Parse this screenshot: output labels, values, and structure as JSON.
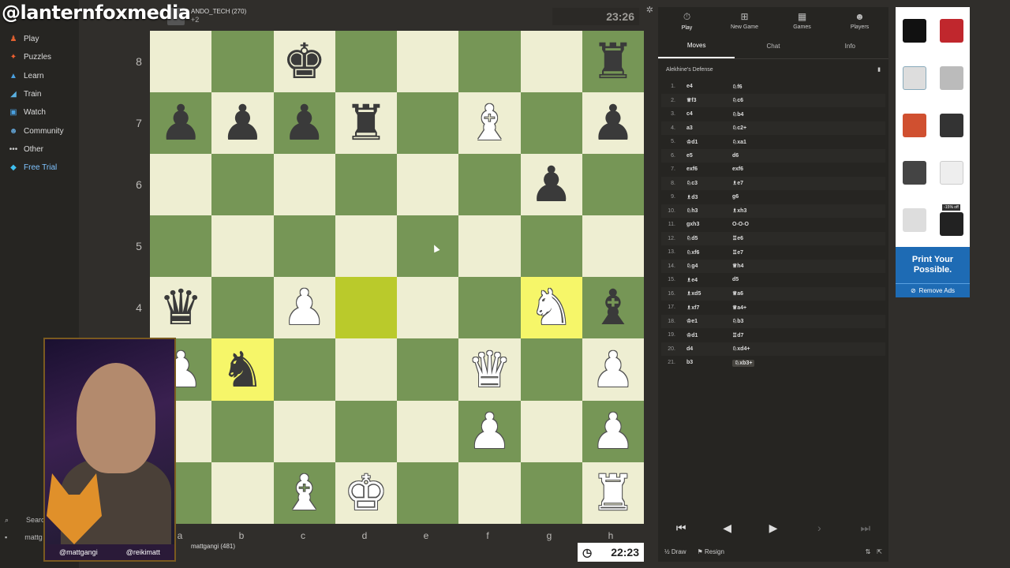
{
  "stream": {
    "handle": "@lanternfoxmedia",
    "socials": [
      "@mattgangi",
      "@reikimatt"
    ]
  },
  "sidebar": {
    "items": [
      {
        "label": "Play",
        "icon": "pawn-icon",
        "color": "#e06030"
      },
      {
        "label": "Puzzles",
        "icon": "puzzle-icon",
        "color": "#f06030"
      },
      {
        "label": "Learn",
        "icon": "learn-icon",
        "color": "#4aa0e0"
      },
      {
        "label": "Train",
        "icon": "train-icon",
        "color": "#5ab0e0"
      },
      {
        "label": "Watch",
        "icon": "watch-icon",
        "color": "#4aa0e0"
      },
      {
        "label": "Community",
        "icon": "community-icon",
        "color": "#60a0d0"
      },
      {
        "label": "Other",
        "icon": "more-icon",
        "color": "#ccc"
      },
      {
        "label": "Free Trial",
        "icon": "diamond-icon",
        "color": "#40c0f0"
      }
    ],
    "search_label": "Search",
    "user_label": "mattg"
  },
  "opponent": {
    "name": "ANDO_TECH (270)",
    "captured": "+2",
    "clock": "23:26"
  },
  "player": {
    "name": "mattgangi (481)",
    "clock": "22:23"
  },
  "board": {
    "ranks": [
      "8",
      "7",
      "6",
      "5",
      "4",
      "3",
      "2",
      "1"
    ],
    "files": [
      "a",
      "b",
      "c",
      "d",
      "e",
      "f",
      "g",
      "h"
    ]
  },
  "panel": {
    "tabs": [
      {
        "label": "Play",
        "icon": "stopwatch-icon"
      },
      {
        "label": "New Game",
        "icon": "plus-icon"
      },
      {
        "label": "Games",
        "icon": "games-icon"
      },
      {
        "label": "Players",
        "icon": "players-icon"
      }
    ],
    "subtabs": [
      "Moves",
      "Chat",
      "Info"
    ],
    "opening": "Alekhine's Defense",
    "moves": [
      {
        "n": "1.",
        "w": "e4",
        "b": "♘f6"
      },
      {
        "n": "2.",
        "w": "♕f3",
        "b": "♘c6"
      },
      {
        "n": "3.",
        "w": "c4",
        "b": "♘b4"
      },
      {
        "n": "4.",
        "w": "a3",
        "b": "♘c2+"
      },
      {
        "n": "5.",
        "w": "♔d1",
        "b": "♘xa1"
      },
      {
        "n": "6.",
        "w": "e5",
        "b": "d6"
      },
      {
        "n": "7.",
        "w": "exf6",
        "b": "exf6"
      },
      {
        "n": "8.",
        "w": "♘c3",
        "b": "♗e7"
      },
      {
        "n": "9.",
        "w": "♗d3",
        "b": "g6"
      },
      {
        "n": "10.",
        "w": "♘h3",
        "b": "♗xh3"
      },
      {
        "n": "11.",
        "w": "gxh3",
        "b": "O-O-O"
      },
      {
        "n": "12.",
        "w": "♘d5",
        "b": "♖e6"
      },
      {
        "n": "13.",
        "w": "♘xf6",
        "b": "♖e7"
      },
      {
        "n": "14.",
        "w": "♘g4",
        "b": "♕h4"
      },
      {
        "n": "15.",
        "w": "♗e4",
        "b": "d5"
      },
      {
        "n": "16.",
        "w": "♗xd5",
        "b": "♕a6"
      },
      {
        "n": "17.",
        "w": "♗xf7",
        "b": "♕a4+"
      },
      {
        "n": "18.",
        "w": "♔e1",
        "b": "♘b3"
      },
      {
        "n": "19.",
        "w": "♔d1",
        "b": "♖d7"
      },
      {
        "n": "20.",
        "w": "d4",
        "b": "♘xd4+"
      },
      {
        "n": "21.",
        "w": "b3",
        "b": "♘xb3+"
      }
    ],
    "draw_label": "Draw",
    "resign_label": "Resign"
  },
  "ad": {
    "banner": "Print Your Possible.",
    "remove": "Remove Ads",
    "badge": "-15% off",
    "colors": {
      "brand": "#1e6bb4"
    }
  },
  "colors": {
    "light_square": "#eeeed2",
    "dark_square": "#769656",
    "highlight_light": "#f6f669",
    "highlight_dark": "#baca2b"
  }
}
